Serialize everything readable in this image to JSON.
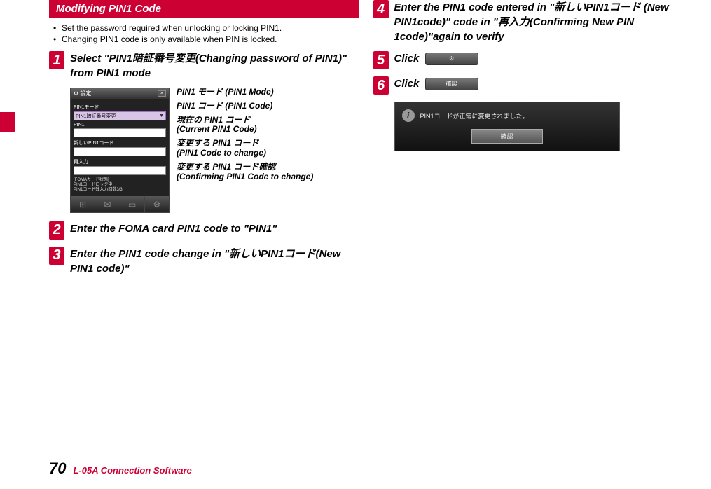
{
  "header": {
    "title": "Modifying PIN1 Code"
  },
  "bullets": [
    "Set the password required when unlocking or locking PIN1.",
    "Changing PIN1 code is only available when PIN is locked."
  ],
  "steps": {
    "s1": {
      "num": "1",
      "text": "Select \"PIN1暗証番号変更(Changing password of PIN1)\" from PIN1 mode"
    },
    "s2": {
      "num": "2",
      "text": "Enter the FOMA card PIN1 code to \"PIN1\""
    },
    "s3": {
      "num": "3",
      "text": "Enter the PIN1 code change in \"新しいPIN1コード(New PIN1 code)\""
    },
    "s4": {
      "num": "4",
      "text": "Enter the PIN1 code entered in \"新しいPIN1コード (New PIN1code)\" code in \"再入力(Confirming New PIN 1code)\"again to verify"
    },
    "s5": {
      "num": "5",
      "text": "Click"
    },
    "s6": {
      "num": "6",
      "text": "Click"
    }
  },
  "phone": {
    "window_title": "設定",
    "labels": {
      "mode": "PIN1モード",
      "mode_value": "PIN1暗証番号変更",
      "pin1": "PIN1",
      "new": "新しいPIN1コード",
      "re": "再入力"
    },
    "status_title": "[FOMAカード状態]",
    "status_line1": "PIN1コードロック中",
    "status_line2": "PIN1コード残入力回数3/3"
  },
  "callouts": {
    "c1": "PIN1 モード (PIN1 Mode)",
    "c2": "PIN1 コード (PIN1 Code)",
    "c3a": "現在の PIN1 コード",
    "c3b": "(Current PIN1 Code)",
    "c4a": "変更する PIN1 コード",
    "c4b": "(PIN1 Code to change)",
    "c5a": "変更する PIN1 コード確認",
    "c5b": "(Confirming PIN1 Code to change)"
  },
  "buttons": {
    "gear": "⚙",
    "confirm": "確認"
  },
  "dialog": {
    "message": "PIN1コードが正常に変更されました。",
    "ok": "確認"
  },
  "footer": {
    "page": "70",
    "title": "L-05A Connection Software"
  }
}
